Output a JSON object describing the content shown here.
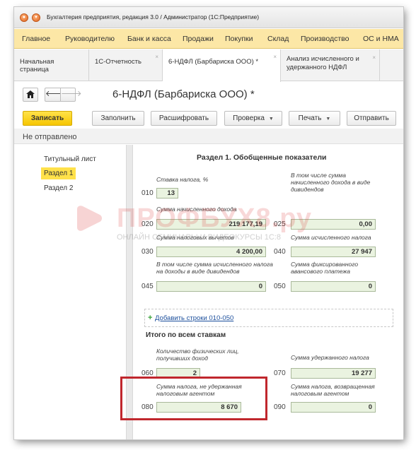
{
  "window": {
    "title": "Бухгалтерия предприятия, редакция 3.0 / Администратор  (1С:Предприятие)"
  },
  "menu": [
    "Главное",
    "Руководителю",
    "Банк и касса",
    "Продажи",
    "Покупки",
    "Склад",
    "Производство",
    "ОС и НМА"
  ],
  "tabs": [
    {
      "label": "Начальная страница"
    },
    {
      "label": "1С-Отчетность"
    },
    {
      "label": "6-НДФЛ (Барбариска ООО) *"
    },
    {
      "label": "Анализ исчисленного и удержанного НДФЛ"
    }
  ],
  "document": {
    "title": "6-НДФЛ (Барбариска ООО) *"
  },
  "toolbar": {
    "save": "Записать",
    "fill": "Заполнить",
    "decode": "Расшифровать",
    "check": "Проверка",
    "print": "Печать",
    "send": "Отправить"
  },
  "status": "Не отправлено",
  "sidebar": [
    "Титульный лист",
    "Раздел 1",
    "Раздел 2"
  ],
  "section": {
    "title": "Раздел 1. Обобщенные показатели",
    "add_rows": "Добавить строки 010-050",
    "totals_title": "Итого по всем ставкам"
  },
  "fields": {
    "f010": {
      "code": "010",
      "label": "Ставка налога, %",
      "value": "13"
    },
    "f020": {
      "code": "020",
      "label": "Сумма начисленного дохода",
      "value": "219 177,19"
    },
    "f025": {
      "code": "025",
      "label": "В том числе сумма начисленного дохода в виде дивидендов",
      "value": "0,00"
    },
    "f030": {
      "code": "030",
      "label": "Сумма налоговых вычетов",
      "value": "4 200,00"
    },
    "f040": {
      "code": "040",
      "label": "Сумма исчисленного налога",
      "value": "27 947"
    },
    "f045": {
      "code": "045",
      "label": "В том числе сумма исчисленного налога на доходы в виде дивидендов",
      "value": "0"
    },
    "f050": {
      "code": "050",
      "label": "Сумма фиксированного авансового платежа",
      "value": "0"
    },
    "f060": {
      "code": "060",
      "label": "Количество физических лиц, получивших доход",
      "value": "2"
    },
    "f070": {
      "code": "070",
      "label": "Сумма удержанного налога",
      "value": "19 277"
    },
    "f080": {
      "code": "080",
      "label": "Сумма налога, не удержанная налоговым агентом",
      "value": "8 670"
    },
    "f090": {
      "code": "090",
      "label": "Сумма налога, возвращенная налоговым агентом",
      "value": "0"
    }
  },
  "watermark": {
    "brand": "ПРОФБУХ8.ру",
    "sub": "ОНЛАЙН СЕМИНАРЫ И ВИДЕОКУРСЫ 1С:8"
  },
  "colors": {
    "menu_bg": "#fce7a6",
    "primary_button": "#f6c600",
    "field_bg": "#eaf3e0",
    "highlight_frame": "#c0272d",
    "link": "#1c4f9c"
  }
}
